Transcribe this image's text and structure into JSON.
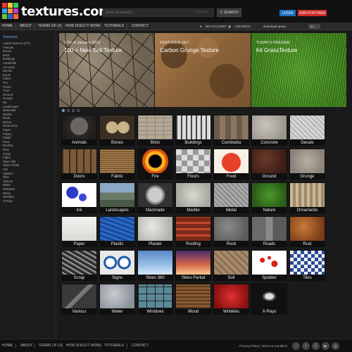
{
  "header": {
    "logo_text": "textures.com",
    "search_placeholder": "Enter Keyword(s)",
    "search_category": "Keywords",
    "search_button": "SEARCH",
    "login_button": "LOGIN",
    "join_button": "JOIN FOR FREE"
  },
  "topnav": {
    "items": [
      "HOME",
      "ABOUT",
      "TERMS OF US",
      "HOW DOES IT WORK",
      "TUTORIALS",
      "CONTACT"
    ],
    "account": "NO ACCOUNT",
    "theme": "LIGHTBOX",
    "download_quota_label": "download quota :",
    "download_quota_value": "15 ↓"
  },
  "sidebar": {
    "heading": "Textures",
    "items": [
      "Latest Textures (277)",
      "Animals",
      "Bones",
      "Brick",
      "Buildings",
      "Cambodia",
      "Concrete",
      "Decals",
      "Doors",
      "Fabric",
      "Fire",
      "Floors",
      "Food",
      "Ground",
      "Grunge",
      "Ink",
      "Landscapes",
      "Manmade",
      "Marble",
      "Metal",
      "Nature",
      "Ornaments",
      "Paper",
      "Plaster",
      "Plastic",
      "Rock",
      "Roofing",
      "Rust",
      "Scrap",
      "Signs",
      "Skies 360",
      "Skies Partial",
      "Soil",
      "Splatter",
      "Tiles",
      "Various",
      "Water",
      "Windows",
      "Wood",
      "Wrinkles",
      "X-Rays"
    ]
  },
  "featured": [
    {
      "label": "17th of January 2012",
      "title": "100 + New Soil Texture"
    },
    {
      "label": "FEATURED SET :",
      "title": "Carbon Grunge Texture"
    },
    {
      "label": "TODAY'S FREEBIE",
      "title": "64 GrassTexture"
    }
  ],
  "categories": [
    "Animals",
    "Bones",
    "Brick",
    "Buildings",
    "Cambodia",
    "Concrete",
    "Decals",
    "Doors",
    "Fabric",
    "Fire",
    "Floors",
    "Food",
    "Ground",
    "Grunge",
    "Ink",
    "Landscapes",
    "Manmade",
    "Marble",
    "Metal",
    "Nature",
    "Ornaments",
    "Paper",
    "Plastic",
    "Plaster",
    "Roofing",
    "Rock",
    "Roads",
    "Rust",
    "Scrap",
    "Signs",
    "Skies 360",
    "Skies Partial",
    "Soil",
    "Splatter",
    "Tiles",
    "Various",
    "Water",
    "Windows",
    "Wood",
    "Wrinkles",
    "X-Rays"
  ],
  "footer": {
    "items": [
      "HOME",
      "ABOUT",
      "TERMS OF US",
      "HOW DOES IT WORK",
      "TUTORIALS",
      "CONTACT"
    ],
    "legal": "Privacy Policy  |  Terms & Condition",
    "social_icons": [
      "rss-icon",
      "facebook-icon",
      "twitter-icon",
      "youtube-icon",
      "google-plus-icon"
    ]
  }
}
